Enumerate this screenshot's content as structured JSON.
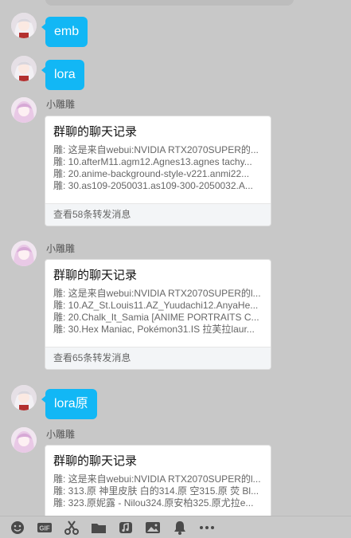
{
  "messages": [
    {
      "type": "self",
      "text": "emb"
    },
    {
      "type": "self",
      "text": "lora"
    },
    {
      "type": "forward",
      "sender": "小雕雕",
      "title": "群聊的聊天记录",
      "lines": [
        "雕: 这是来自webui:NVIDIA RTX2070SUPER的...",
        "雕: 10.afterM11.agm12.Agnes13.agnes tachy...",
        "雕: 20.anime-background-style-v221.anmi22...",
        "雕: 30.as109-2050031.as109-300-2050032.A..."
      ],
      "footer": "查看58条转发消息"
    },
    {
      "type": "forward",
      "sender": "小雕雕",
      "title": "群聊的聊天记录",
      "lines": [
        "雕: 这是来自webui:NVIDIA RTX2070SUPER的l...",
        "雕: 10.AZ_St.Louis11.AZ_Yuudachi12.AnyaHe...",
        "雕: 20.Chalk_It_Samia [ANIME PORTRAITS C...",
        "雕: 30.Hex Maniac, Pokémon31.IS 拉芙拉laur..."
      ],
      "footer": "查看65条转发消息"
    },
    {
      "type": "self",
      "text": "lora原"
    },
    {
      "type": "forward",
      "sender": "小雕雕",
      "title": "群聊的聊天记录",
      "lines": [
        "雕: 这是来自webui:NVIDIA RTX2070SUPER的l...",
        "雕: 313.原 神里皮肤 白的314.原 空315.原 荧 Bl...",
        "雕: 323.原妮露 - Nilou324.原安柏325.原尤拉e..."
      ]
    }
  ],
  "toolbar_icons": [
    "emoji-icon",
    "gif-icon",
    "scissors-icon",
    "folder-icon",
    "music-icon",
    "image-icon",
    "bell-icon",
    "more-icon"
  ],
  "colors": {
    "bubble": "#12b7f5",
    "background": "#c8c8c8"
  }
}
